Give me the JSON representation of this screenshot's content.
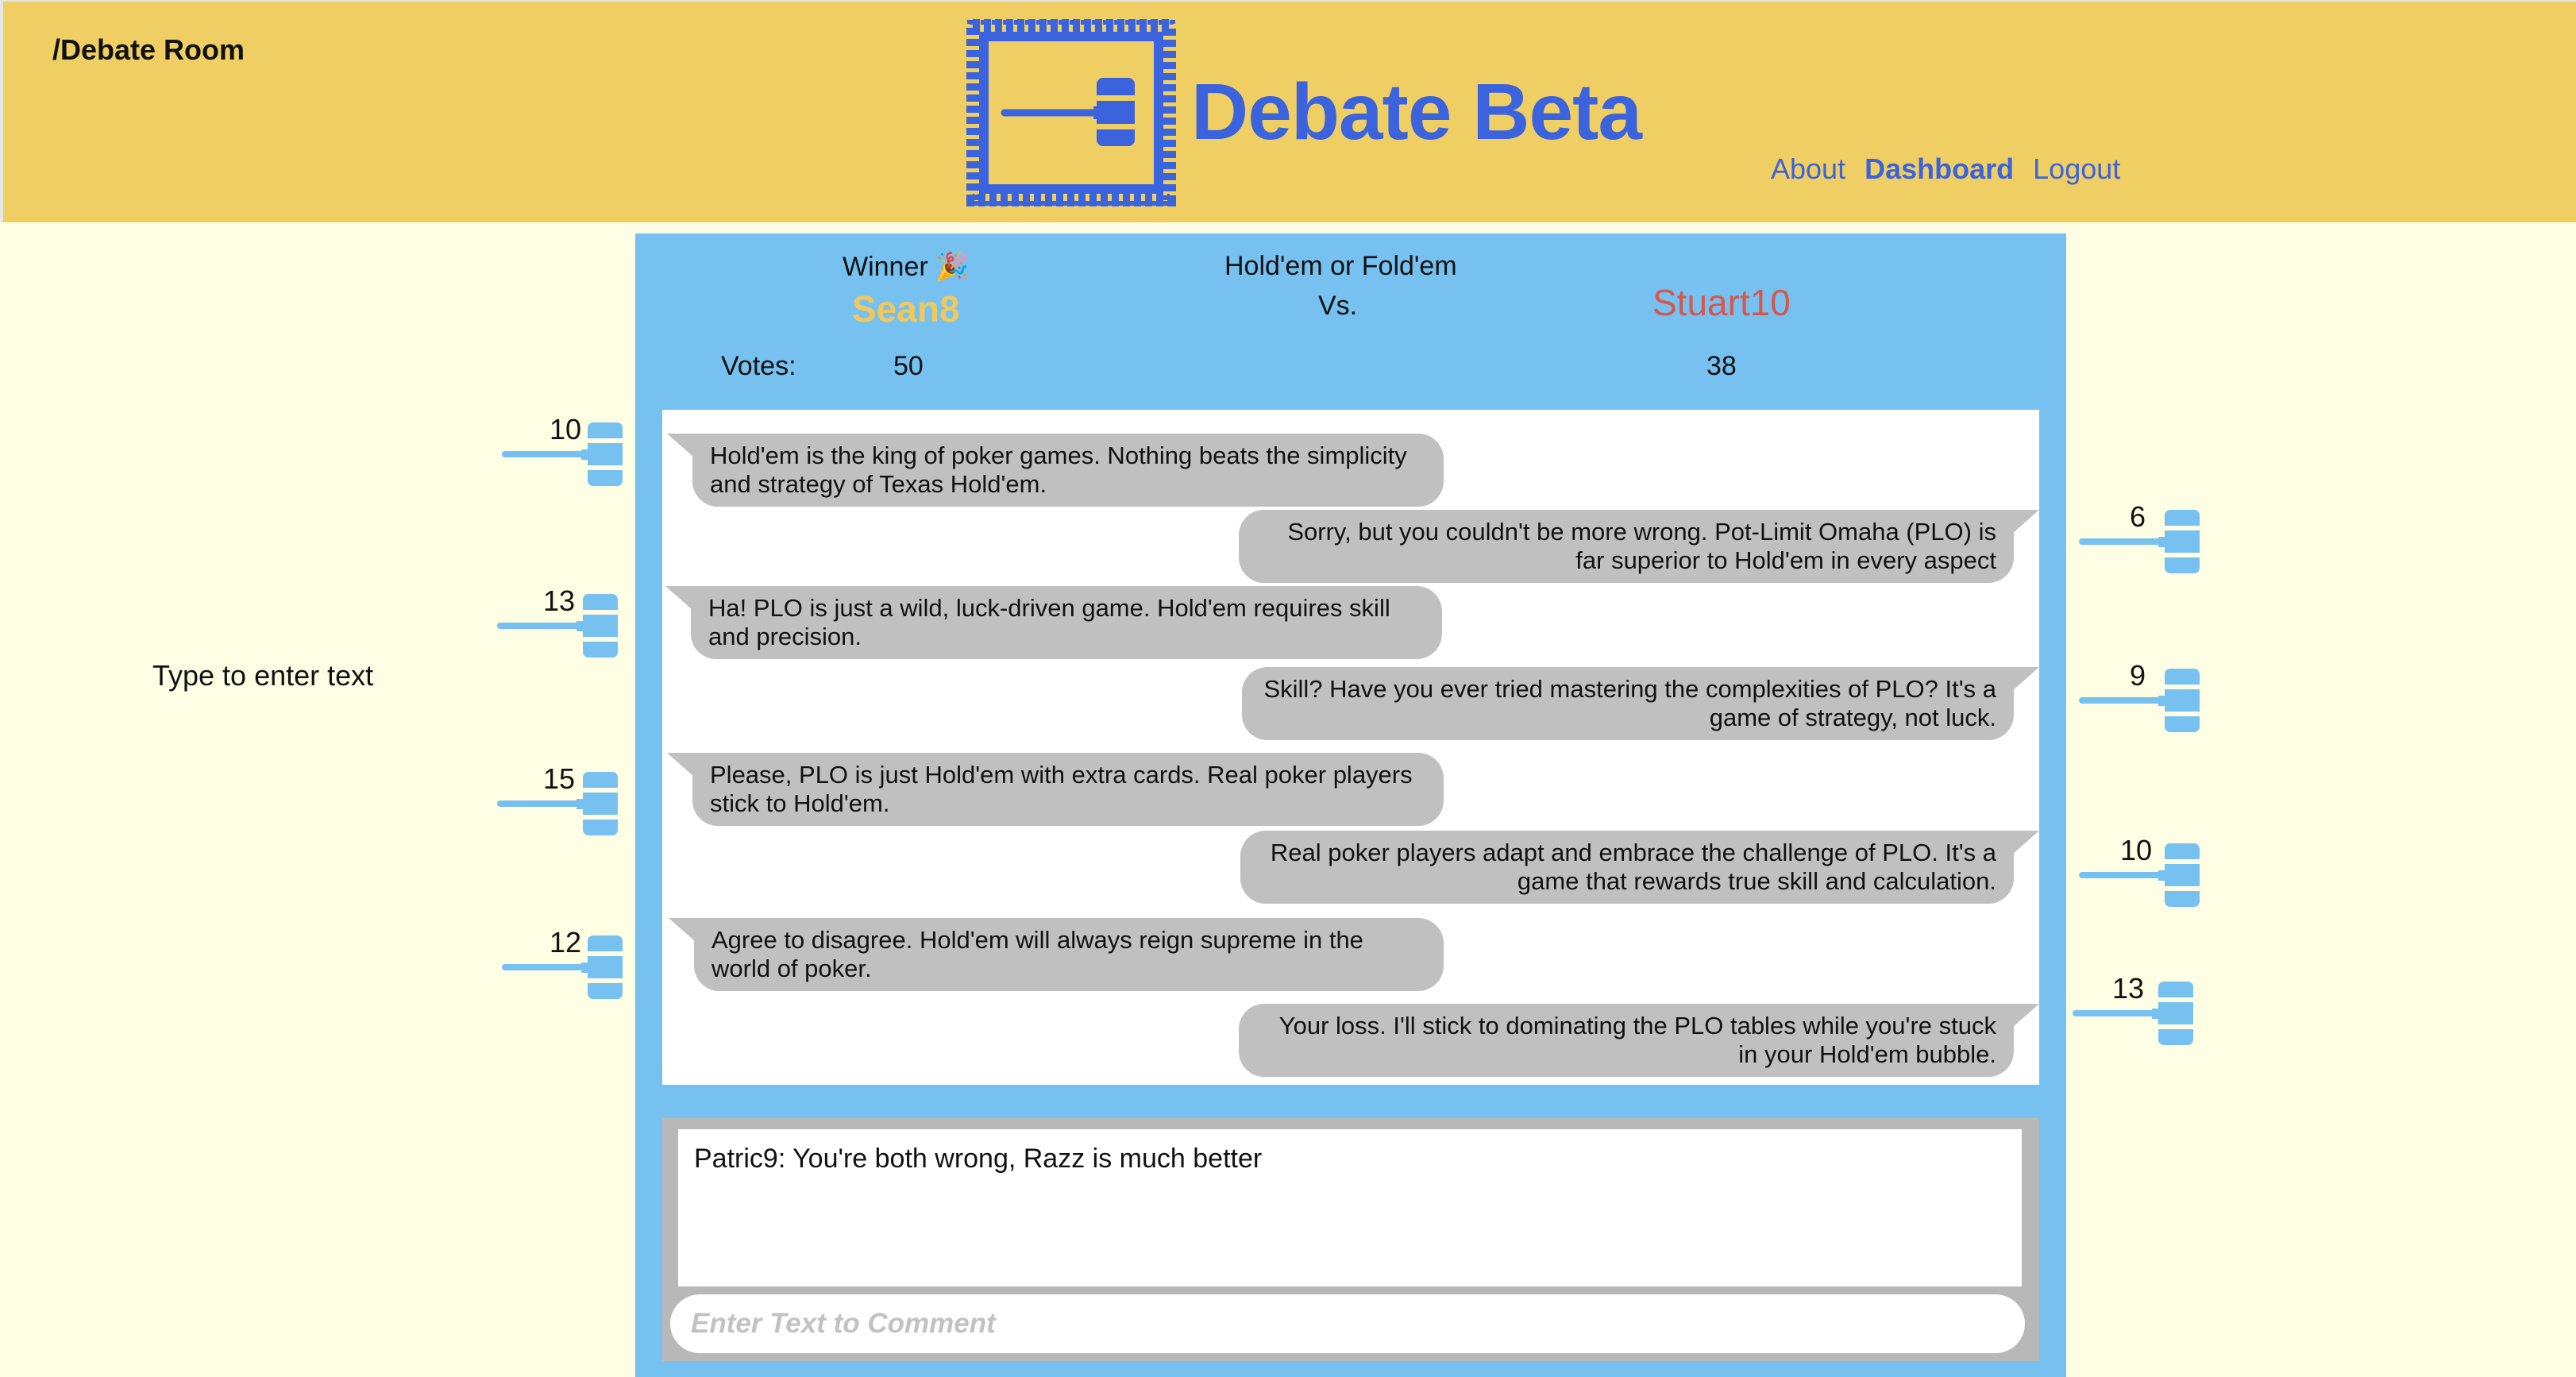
{
  "header": {
    "breadcrumb": "/Debate Room",
    "brand": "Debate Beta",
    "nav": [
      "About",
      "Dashboard",
      "Logout"
    ],
    "active_nav": "Dashboard",
    "colors": {
      "background": "#efcf63",
      "brand": "#3b63dd"
    },
    "logo_icon": "gavel-stamp-icon"
  },
  "debate": {
    "winner_label": "Winner 🎉",
    "topic": "Hold'em or Fold'em",
    "vs": "Vs.",
    "left_user": "Sean8",
    "right_user": "Stuart10",
    "votes_label": "Votes:",
    "left_votes": "50",
    "right_votes": "38",
    "colors": {
      "panel": "#77c1f0",
      "left_user": "#f1c85a",
      "right_user": "#d6574c",
      "bubble": "#c0c0c0"
    }
  },
  "messages": [
    {
      "side": "left",
      "text": "Hold'em is the king of poker games. Nothing beats the simplicity and strategy of Texas Hold'em.",
      "votes": "10"
    },
    {
      "side": "right",
      "text": "Sorry, but you couldn't be more wrong. Pot-Limit Omaha (PLO) is far superior to Hold'em in every aspect",
      "votes": "6"
    },
    {
      "side": "left",
      "text": "Ha! PLO is just a wild, luck-driven game. Hold'em requires skill and precision.",
      "votes": "13"
    },
    {
      "side": "right",
      "text": "Skill? Have you ever tried mastering the complexities of PLO? It's a game of strategy, not luck.",
      "votes": "9"
    },
    {
      "side": "left",
      "text": "Please, PLO is just Hold'em with extra cards. Real poker players stick to Hold'em.",
      "votes": "15"
    },
    {
      "side": "right",
      "text": "Real poker players adapt and embrace the challenge of PLO. It's a game that rewards true skill and calculation.",
      "votes": "10"
    },
    {
      "side": "left",
      "text": "Agree to disagree. Hold'em will always reign supreme in the world of poker.",
      "votes": "12"
    },
    {
      "side": "right",
      "text": "Your loss. I'll stick to dominating the PLO tables while you're stuck in your Hold'em bubble.",
      "votes": "13"
    }
  ],
  "comments": {
    "latest": "Patric9: You're both wrong, Razz is much better",
    "input_placeholder": "Enter Text to Comment"
  },
  "side_hint": "Type to enter text",
  "vote_icon": "gavel-icon"
}
